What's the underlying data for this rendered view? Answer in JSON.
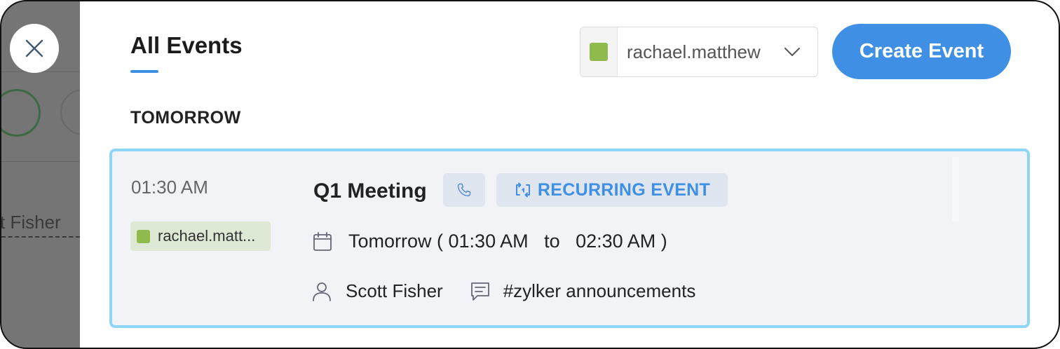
{
  "background": {
    "partial_text": "t Fisher"
  },
  "header": {
    "title": "All Events",
    "user_select": {
      "selected": "rachael.matthew",
      "swatch_color": "#8fbb4c"
    },
    "create_button": "Create Event"
  },
  "section": {
    "label": "TOMORROW"
  },
  "event": {
    "time": "01:30 AM",
    "owner": "rachael.matt...",
    "title": "Q1 Meeting",
    "recurring_label": "RECURRING EVENT",
    "date_text": "Tomorrow ( 01:30 AM   to   02:30 AM )",
    "organizer": "Scott Fisher",
    "channel": "#zylker announcements"
  },
  "colors": {
    "accent": "#3f8fe4",
    "card_border": "#8fd6f6",
    "owner_color": "#8fbb4c"
  }
}
